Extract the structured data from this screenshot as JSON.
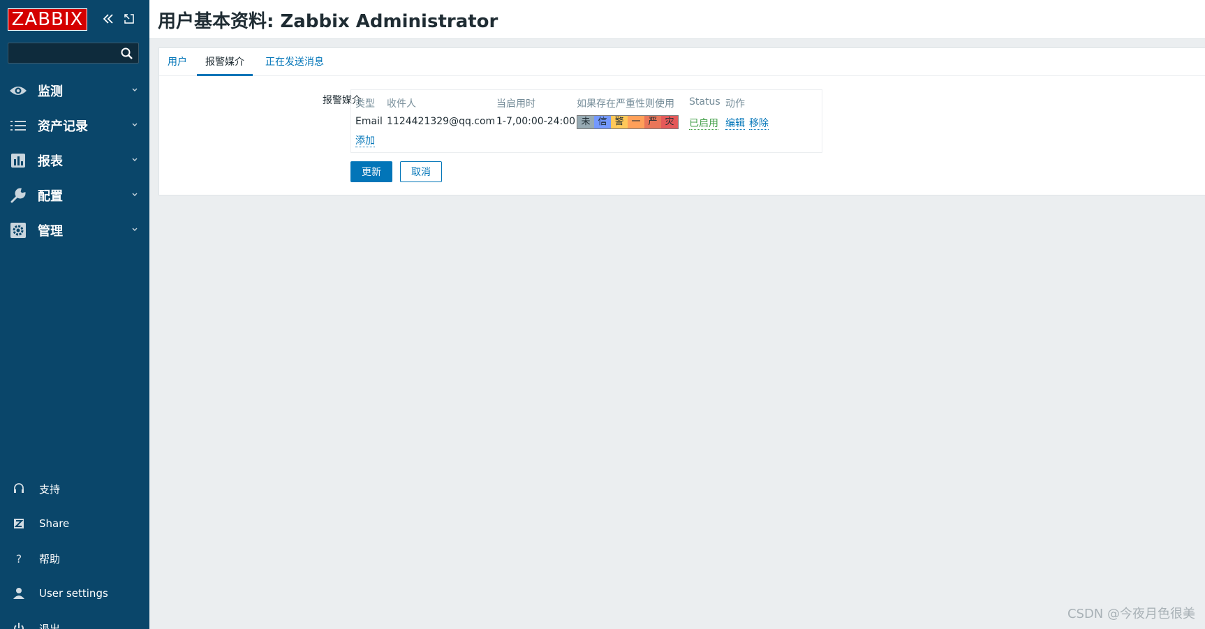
{
  "app": {
    "logo_text": "ZABBIX",
    "collapse_icon": "double-chevron-left-icon",
    "kiosk_icon": "expand-icon"
  },
  "search": {
    "value": "",
    "placeholder": ""
  },
  "nav": {
    "items": [
      {
        "label": "监测",
        "icon": "eye-icon"
      },
      {
        "label": "资产记录",
        "icon": "list-icon"
      },
      {
        "label": "报表",
        "icon": "bar-chart-icon"
      },
      {
        "label": "配置",
        "icon": "wrench-icon"
      },
      {
        "label": "管理",
        "icon": "gear-icon"
      }
    ],
    "footer": [
      {
        "label": "支持",
        "icon": "headset-icon"
      },
      {
        "label": "Share",
        "icon": "zabbix-share-icon"
      },
      {
        "label": "帮助",
        "icon": "help-icon"
      },
      {
        "label": "User settings",
        "icon": "user-icon"
      },
      {
        "label": "退出",
        "icon": "power-icon"
      }
    ]
  },
  "header": {
    "title": "用户基本资料: Zabbix Administrator"
  },
  "tabs": [
    {
      "label": "用户",
      "active": false
    },
    {
      "label": "报警媒介",
      "active": true
    },
    {
      "label": "正在发送消息",
      "active": false
    }
  ],
  "media": {
    "field_label": "报警媒介",
    "columns": [
      "类型",
      "收件人",
      "当启用时",
      "如果存在严重性则使用",
      "Status",
      "动作"
    ],
    "row": {
      "type": "Email",
      "recipient": "1124421329@qq.com",
      "when_active": "1-7,00:00-24:00",
      "severities": [
        {
          "label": "未",
          "color": "#97aab3"
        },
        {
          "label": "信",
          "color": "#7499ff"
        },
        {
          "label": "警",
          "color": "#ffc859"
        },
        {
          "label": "一",
          "color": "#ffa059"
        },
        {
          "label": "严",
          "color": "#e97659"
        },
        {
          "label": "灾",
          "color": "#e45959"
        }
      ],
      "status": "已启用",
      "actions": [
        "编辑",
        "移除"
      ]
    },
    "add_label": "添加"
  },
  "buttons": {
    "update": "更新",
    "cancel": "取消"
  },
  "watermark": "CSDN @今夜月色很美",
  "colors": {
    "sidebar": "#0a466a",
    "accent": "#0275b8",
    "logo": "#d40000",
    "enabled": "#429e47",
    "background": "#ebeef0"
  }
}
